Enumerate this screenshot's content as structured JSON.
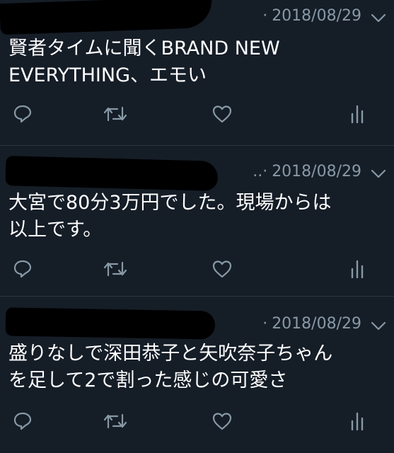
{
  "tweets": [
    {
      "separator": "·",
      "date": "2018/08/29",
      "text_lines": [
        "賢者タイムに聞くBRAND NEW",
        "EVERYTHING、エモい"
      ]
    },
    {
      "separator": "..·",
      "date": "2018/08/29",
      "text_lines": [
        "大宮で80分3万円でした。現場からは",
        "以上です。"
      ]
    },
    {
      "separator": "·",
      "date": "2018/08/29",
      "text_lines": [
        "盛りなしで深田恭子と矢吹奈子ちゃん",
        "を足して2で割った感じの可愛さ"
      ]
    }
  ],
  "icons": {
    "menu": "chevron-down-icon",
    "reply": "reply-icon",
    "retweet": "retweet-icon",
    "like": "heart-icon",
    "analytics": "analytics-icon"
  },
  "colors": {
    "background": "#151d27",
    "meta": "#8899a6",
    "text": "#ffffff",
    "divider": "#2c3641"
  }
}
